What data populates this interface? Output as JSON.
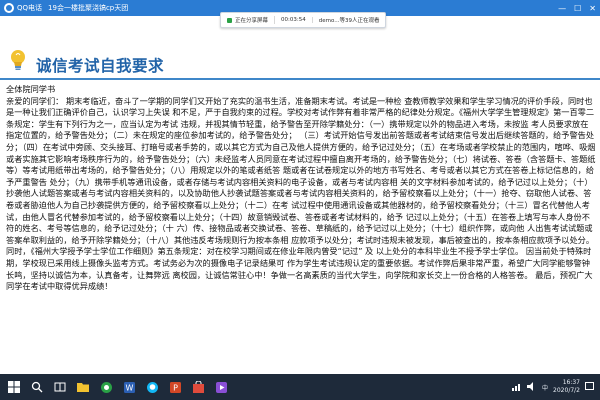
{
  "qq_bar": {
    "app": "QQ电话",
    "group": "19会一楼批聚浇镐cp天团",
    "controls": [
      "—",
      "☐",
      "✕"
    ]
  },
  "share_banner": {
    "status": "正在分享屏幕",
    "timer": "00:03:54",
    "presenter": "demo...等39人正在观看"
  },
  "document": {
    "title": "诚信考试自我要求",
    "paragraphs": [
      "全体院同学书",
      "亲爱的同学们： 期末考临近，奋斗了一学期的同学们又开始了充实的温书生活，准备期末考试。考试是一种检 查教师教学效果和学生学习情况的评价手段，同时也是一种让我们正确评价自己，认识学习上失误 和不足，严于自我约束的过程。学校对考试作弊有着非常严格的纪律处分规定。《福州大学学生管理规定》第一百零二条规定：学生有下列行为之一，应当认定为考试 违规，并视其情节轻重，给予警告至开除学籍处分：（一）携带规定以外的物品进入考场，未按监 考人员要求放在指定位置的，给予警告处分；（二）未在规定的座位参加考试的，给予警告处分； （三）考试开始信号发出前答题或者考试结束信号发出后继续答题的，给予警告处分；（四）在考试中旁顾、交头接耳、打暗号或者手势的，或以其它方式为自己及他人提供方便的，给予记过处分；（五）在考场或者学校禁止的范围内，喧哗、吸烟或者实施其它影响考场秩序行为的，给予警告处分；（六）未经监考人员同意在考试过程中擅自离开考场的，给予警告处分；（七）将试卷、答卷（含答题卡、答题纸等）等考试用纸带出考场的，给予警告处分；（八）用规定以外的笔或者纸答 题或者在试卷规定以外的地方书写姓名、考号或者以其它方式在答卷上标记信息的，给予严重警告 处分；（九）携带手机等通讯设备，或者存储与考试内容相关资料的电子设备，或者与考试内容相 关的文字材料参加考试的，给予记过以上处分；（十）抄袭他人试题答案或者与考试内容相关资料的，以及协助他人抄袭试题答案或者与考试内容相关资料的，给予留校察看以上处分；（十一）抢夺、窃取他人试卷、答卷或者胁迫他人为自己抄袭提供方便的，给予留校察看以上处分；（十二）在考 试过程中使用通讯设备或其他器材的，给予留校察看处分；（十三）冒名代替他人考试，由他人冒名代替参加考试的，给予留校察看以上处分；（十四）故意销毁试卷、答卷或者考试材料的，给予 记过以上处分；（十五）在答卷上填写与本人身份不符的姓名、考号等信息的，给予记过处分；（十 六）传、接物品或者交换试卷、答卷、草稿纸的，给予记过以上处分；（十七）组织作弊，或向他 人出售考试试题或答案牟取利益的，给予开除学籍处分；（十八）其他违反考场规则行为按本条相 应款项予以处分；考试时违规未被发现，事后被查出的，按本条相应款项予以处分。",
      "同时，《福州大学授予学士学位工作细则》第五条规定：对在校学习期间或在修业年限内曾受“记过” 及 以上处分的本科毕业生不授予学士学位。 因当前处于特殊时期，学校现已采用线上摄像头监考方式。考试务必为次的摄像电子记录结果可 作为学生考试违规认定的重要依据。考试作弊后果非常严重，希望广大同学能够警钟长鸣，坚持以诚信为本，认真备考，让舞弊远 离校园，让诚信常驻心中！争做一名高素质的当代大学生，向学院和家长交上一份合格的人格答卷。 最后，预祝广大同学在考试中取得优异成绩！"
    ]
  },
  "taskbar": {
    "icons": [
      "windows-icon",
      "search-icon",
      "task-view-icon",
      "folder-icon",
      "browser-icon",
      "word-icon",
      "qq-icon",
      "powerpoint-icon",
      "store-icon",
      "media-icon"
    ],
    "time": "16:37",
    "date": "2020/7/2",
    "ime": "中"
  },
  "colors": {
    "qq_blue": "#2b7cd3",
    "title_blue": "#2163a8",
    "taskbar": "#1e2a3a"
  }
}
